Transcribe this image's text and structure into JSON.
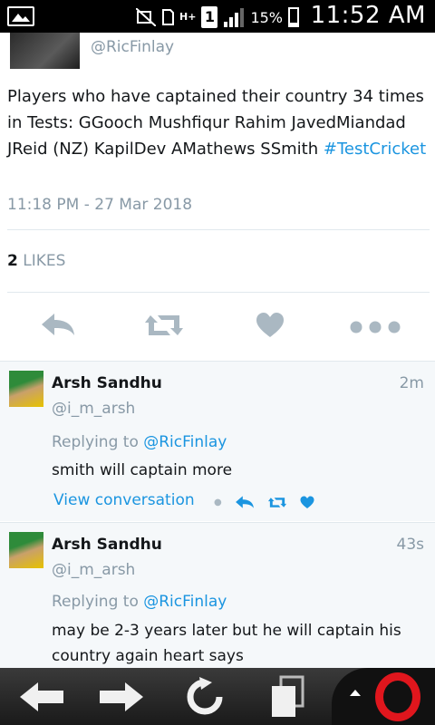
{
  "status_bar": {
    "network": "H+",
    "sim": "1",
    "battery_pct": "15%",
    "time": "11:52 AM"
  },
  "tweet": {
    "author_handle": "@RicFinlay",
    "text_main": "Players who have captained their country 34 times in Tests: GGooch Mushfiqur Rahim JavedMiandad JReid (NZ) KapilDev AMathews SSmith ",
    "hashtag": "#TestCricket",
    "timestamp": "11:18 PM - 27 Mar 2018",
    "likes_count": "2",
    "likes_label": "LIKES"
  },
  "replies": [
    {
      "name": "Arsh Sandhu",
      "handle": "@i_m_arsh",
      "time": "2m",
      "replying_prefix": "Replying to ",
      "replying_to": "@RicFinlay",
      "text": "smith will captain more",
      "view_conversation": "View conversation"
    },
    {
      "name": "Arsh Sandhu",
      "handle": "@i_m_arsh",
      "time": "43s",
      "replying_prefix": "Replying to ",
      "replying_to": "@RicFinlay",
      "text": "may be 2-3 years later but he will captain his country again heart says"
    }
  ],
  "colors": {
    "link": "#1b95e0",
    "muted": "#8899a6",
    "reply_bg": "#f5f8fa",
    "opera_red": "#e0161d"
  },
  "icons": [
    "reply-icon",
    "retweet-icon",
    "like-icon",
    "more-icon",
    "back-arrow-icon",
    "forward-arrow-icon",
    "reload-icon",
    "tabs-icon",
    "opera-icon"
  ]
}
